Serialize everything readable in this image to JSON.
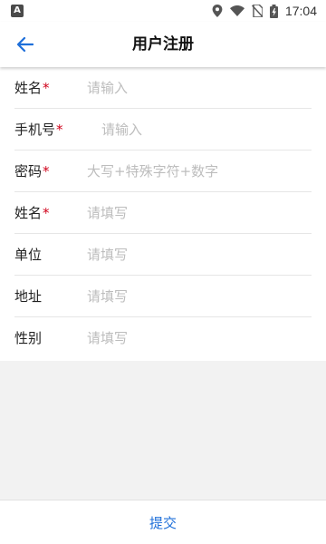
{
  "status_bar": {
    "time": "17:04",
    "left_icon": "A",
    "icons": [
      "location-icon",
      "wifi-icon",
      "no-sim-icon",
      "battery-charging-icon"
    ]
  },
  "header": {
    "title": "用户注册",
    "back_icon": "arrow-left-icon",
    "accent_color": "#1e6fd9"
  },
  "form": {
    "fields": [
      {
        "label": "姓名",
        "required": "*",
        "placeholder": "请输入",
        "value": ""
      },
      {
        "label": "手机号",
        "required": "*",
        "placeholder": "请输入",
        "value": ""
      },
      {
        "label": "密码",
        "required": "*",
        "placeholder": "大写+特殊字符+数字",
        "value": ""
      },
      {
        "label": "姓名",
        "required": "*",
        "placeholder": "请填写",
        "value": ""
      },
      {
        "label": "单位",
        "required": "",
        "placeholder": "请填写",
        "value": ""
      },
      {
        "label": "地址",
        "required": "",
        "placeholder": "请填写",
        "value": ""
      },
      {
        "label": "性别",
        "required": "",
        "placeholder": "请填写",
        "value": ""
      }
    ]
  },
  "footer": {
    "submit_label": "提交"
  }
}
